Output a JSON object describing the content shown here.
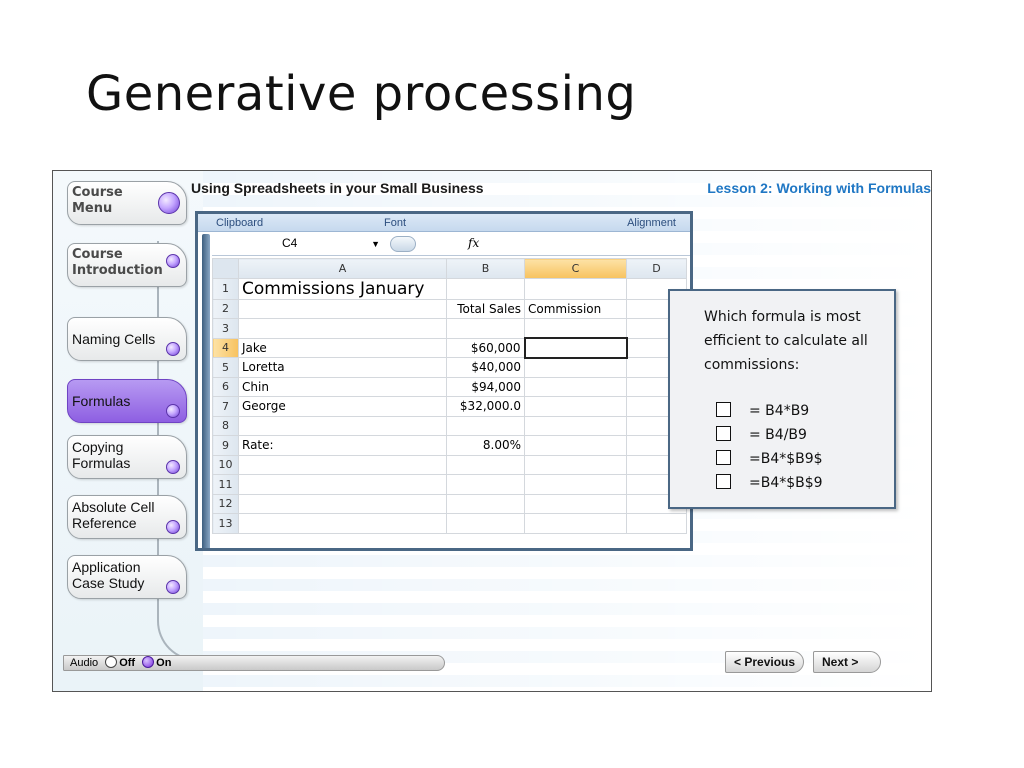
{
  "slide": {
    "title": "Generative processing"
  },
  "module": {
    "header_title": "Using Spreadsheets in your Small Business",
    "lesson_title": "Lesson 2: Working with Formulas"
  },
  "nav": {
    "items": [
      {
        "label": "Course\nMenu"
      },
      {
        "label": "Course\nIntroduction"
      },
      {
        "label": "Naming Cells"
      },
      {
        "label": "Formulas"
      },
      {
        "label": "Copying\nFormulas"
      },
      {
        "label": "Absolute Cell\nReference"
      },
      {
        "label": "Application\nCase Study"
      }
    ]
  },
  "spreadsheet": {
    "ribbon": [
      "Clipboard",
      "Font",
      "Alignment"
    ],
    "name_box": "C4",
    "fx": "fx",
    "columns": [
      "A",
      "B",
      "C",
      "D"
    ],
    "rows": [
      {
        "n": "1",
        "a": "Commissions January",
        "b": "",
        "c": ""
      },
      {
        "n": "2",
        "a": "",
        "b": "Total Sales",
        "c": "Commission"
      },
      {
        "n": "3",
        "a": "",
        "b": "",
        "c": ""
      },
      {
        "n": "4",
        "a": "Jake",
        "b": "$60,000",
        "c": ""
      },
      {
        "n": "5",
        "a": "Loretta",
        "b": "$40,000",
        "c": ""
      },
      {
        "n": "6",
        "a": "Chin",
        "b": "$94,000",
        "c": ""
      },
      {
        "n": "7",
        "a": "George",
        "b": "$32,000.0",
        "c": ""
      },
      {
        "n": "8",
        "a": "",
        "b": "",
        "c": ""
      },
      {
        "n": "9",
        "a": "Rate:",
        "b": "8.00%",
        "c": ""
      },
      {
        "n": "10",
        "a": "",
        "b": "",
        "c": ""
      },
      {
        "n": "11",
        "a": "",
        "b": "",
        "c": ""
      },
      {
        "n": "12",
        "a": "",
        "b": "",
        "c": ""
      },
      {
        "n": "13",
        "a": "",
        "b": "",
        "c": ""
      }
    ]
  },
  "question": {
    "text": "Which formula is most efficient to calculate all commissions:",
    "options": [
      "= B4*B9",
      "= B4/B9",
      "=B4*$B9$",
      "=B4*$B$9"
    ]
  },
  "footer": {
    "audio_label": "Audio",
    "off_label": "Off",
    "on_label": "On",
    "previous_label": "< Previous",
    "next_label": "Next >"
  },
  "colors": {
    "accent_purple": "#8e5fe2",
    "lesson_blue": "#1f77c4",
    "frame_blue": "#4a6784"
  }
}
